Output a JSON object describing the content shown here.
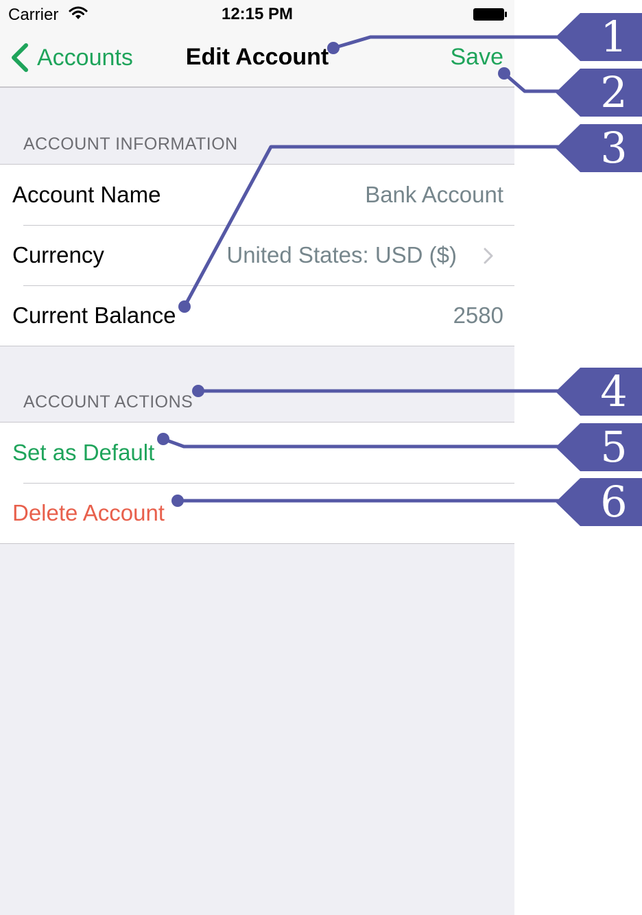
{
  "status_bar": {
    "carrier": "Carrier",
    "time": "12:15 PM",
    "wifi_icon": "wifi-icon",
    "battery_icon": "battery-icon"
  },
  "nav_bar": {
    "back_label": "Accounts",
    "back_icon": "chevron-left-icon",
    "title": "Edit Account",
    "save_label": "Save"
  },
  "account_information": {
    "header": "ACCOUNT INFORMATION",
    "rows": [
      {
        "label": "Account Name",
        "value": "Bank Account"
      },
      {
        "label": "Currency",
        "value": "United States: USD ($)"
      },
      {
        "label": "Current Balance",
        "value": "2580"
      }
    ]
  },
  "account_actions": {
    "header": "ACCOUNT ACTIONS",
    "set_default_label": "Set as Default",
    "delete_label": "Delete Account"
  },
  "callouts": [
    "1",
    "2",
    "3",
    "4",
    "5",
    "6"
  ],
  "colors": {
    "accent_green": "#1fa45b",
    "destructive_red": "#e8604c",
    "callout_purple": "#5558a5",
    "background_gray": "#efeff4",
    "value_gray": "#76868c"
  }
}
